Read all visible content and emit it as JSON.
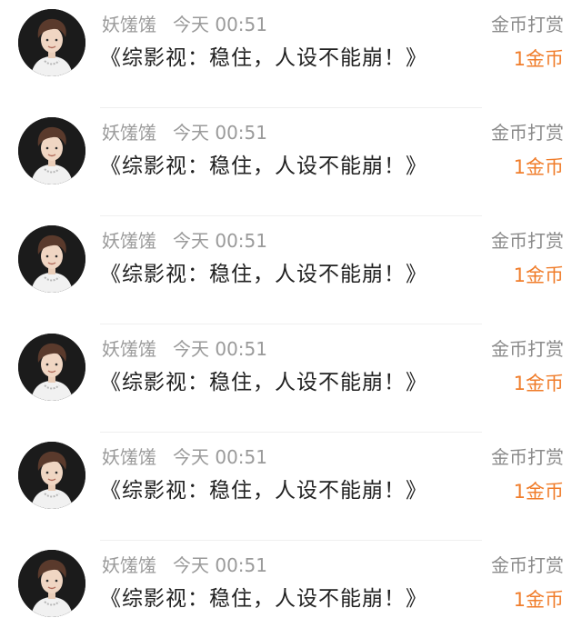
{
  "colors": {
    "username": "#9a9a9a",
    "title": "#222222",
    "kind": "#8a8a8a",
    "amount": "#f07d2b"
  },
  "records": [
    {
      "username": "妖馐馐",
      "time": "今天 00:51",
      "book_title": "《综影视：稳住，人设不能崩！》",
      "kind": "金币打赏",
      "amount": "1金币",
      "avatar_icon": "user-avatar-photo"
    },
    {
      "username": "妖馐馐",
      "time": "今天 00:51",
      "book_title": "《综影视：稳住，人设不能崩！》",
      "kind": "金币打赏",
      "amount": "1金币",
      "avatar_icon": "user-avatar-photo"
    },
    {
      "username": "妖馐馐",
      "time": "今天 00:51",
      "book_title": "《综影视：稳住，人设不能崩！》",
      "kind": "金币打赏",
      "amount": "1金币",
      "avatar_icon": "user-avatar-photo"
    },
    {
      "username": "妖馐馐",
      "time": "今天 00:51",
      "book_title": "《综影视：稳住，人设不能崩！》",
      "kind": "金币打赏",
      "amount": "1金币",
      "avatar_icon": "user-avatar-photo"
    },
    {
      "username": "妖馐馐",
      "time": "今天 00:51",
      "book_title": "《综影视：稳住，人设不能崩！》",
      "kind": "金币打赏",
      "amount": "1金币",
      "avatar_icon": "user-avatar-photo"
    },
    {
      "username": "妖馐馐",
      "time": "今天 00:51",
      "book_title": "《综影视：稳住，人设不能崩！》",
      "kind": "金币打赏",
      "amount": "1金币",
      "avatar_icon": "user-avatar-photo"
    }
  ]
}
